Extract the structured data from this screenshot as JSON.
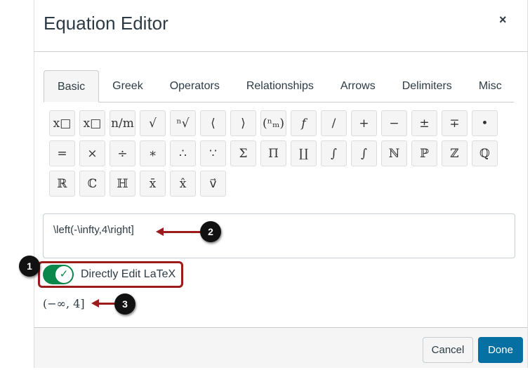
{
  "dialog": {
    "title": "Equation Editor",
    "close": "×"
  },
  "tabs": [
    "Basic",
    "Greek",
    "Operators",
    "Relationships",
    "Arrows",
    "Delimiters",
    "Misc"
  ],
  "symbols": [
    "x□",
    "x□",
    "n/m",
    "√",
    "ⁿ√",
    "⟨",
    "⟩",
    "(ⁿₘ)",
    "𝑓",
    "/",
    "+",
    "−",
    "±",
    "∓",
    "•",
    "=",
    "×",
    "÷",
    "∗",
    "∴",
    "∵",
    "Σ",
    "Π",
    "∐",
    "∫",
    "∫",
    "ℕ",
    "ℙ",
    "ℤ",
    "ℚ",
    "ℝ",
    "ℂ",
    "ℍ",
    "x̄",
    "x̂",
    "v⃗"
  ],
  "latex_input": "\\left(-\\infty,4\\right]",
  "toggle": {
    "label": "Directly Edit LaTeX",
    "checked": true,
    "icon": "check-icon"
  },
  "result": "(−∞, 4]",
  "callouts": [
    "1",
    "2",
    "3"
  ],
  "footer": {
    "cancel": "Cancel",
    "done": "Done"
  },
  "colors": {
    "accent": "#0770a3",
    "toggle": "#0b874b",
    "annotation": "#9b1c1c"
  }
}
